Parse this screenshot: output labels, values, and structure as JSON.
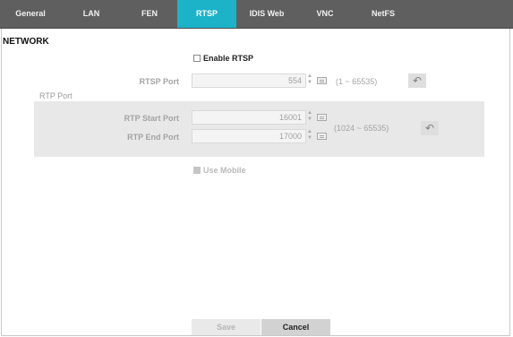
{
  "tabs": [
    {
      "label": "General"
    },
    {
      "label": "LAN"
    },
    {
      "label": "FEN"
    },
    {
      "label": "RTSP",
      "active": true
    },
    {
      "label": "IDIS Web"
    },
    {
      "label": "VNC"
    },
    {
      "label": "NetFS"
    }
  ],
  "section_title": "NETWORK",
  "enable_rtsp": {
    "label": "Enable RTSP",
    "checked": false
  },
  "rtsp_port": {
    "label": "RTSP Port",
    "value": "554",
    "range": "(1 ~ 65535)"
  },
  "rtp_port": {
    "group_label": "RTP Port",
    "start": {
      "label": "RTP Start Port",
      "value": "16001"
    },
    "end": {
      "label": "RTP End Port",
      "value": "17000"
    },
    "range": "(1024 ~ 65535)"
  },
  "use_mobile": {
    "label": "Use Mobile",
    "checked": false,
    "disabled": true
  },
  "buttons": {
    "save": "Save",
    "cancel": "Cancel"
  },
  "icons": {
    "spinner_up": "▲",
    "spinner_down": "▼",
    "undo": "↶"
  },
  "colors": {
    "tab_bar": "#5f5f5f",
    "tab_active": "#1cb3c8",
    "panel": "#e8e8e8"
  }
}
